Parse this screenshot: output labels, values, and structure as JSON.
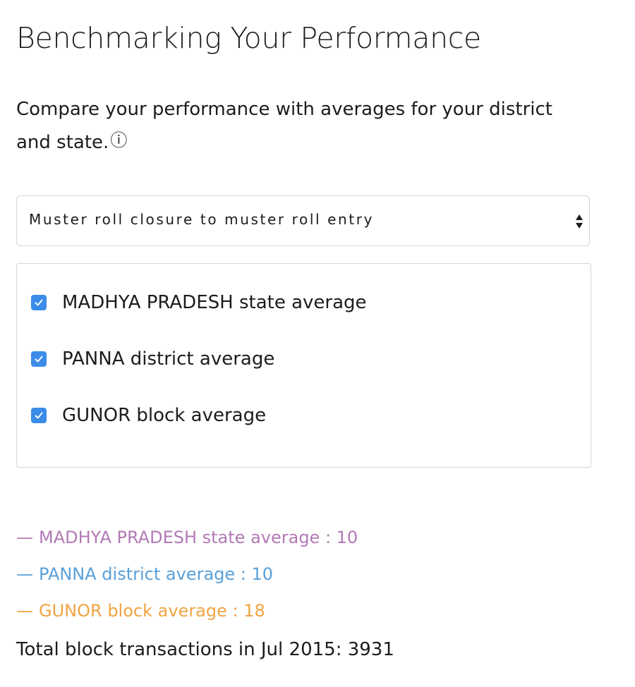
{
  "header": {
    "title": "Benchmarking Your Performance"
  },
  "description": {
    "text": "Compare your performance with averages for your district and state.",
    "info_icon": "ⓘ"
  },
  "metric_select": {
    "selected": "Muster roll closure to muster roll entry",
    "icon": "up-down-arrows-icon"
  },
  "options": [
    {
      "label": "MADHYA PRADESH state average",
      "checked": true
    },
    {
      "label": "PANNA district average",
      "checked": true
    },
    {
      "label": "GUNOR block average",
      "checked": true
    }
  ],
  "legend": [
    {
      "dash": "—",
      "text": "MADHYA PRADESH state average : 10",
      "color": "#b27ab5"
    },
    {
      "dash": "—",
      "text": "PANNA district average : 10",
      "color": "#5aa0d8"
    },
    {
      "dash": "—",
      "text": "GUNOR block average : 18",
      "color": "#f0a443"
    }
  ],
  "summary": {
    "total_text": "Total block transactions in Jul 2015: 3931"
  },
  "colors": {
    "checkbox": "#3b8ce8",
    "border": "#d6d6d6"
  }
}
